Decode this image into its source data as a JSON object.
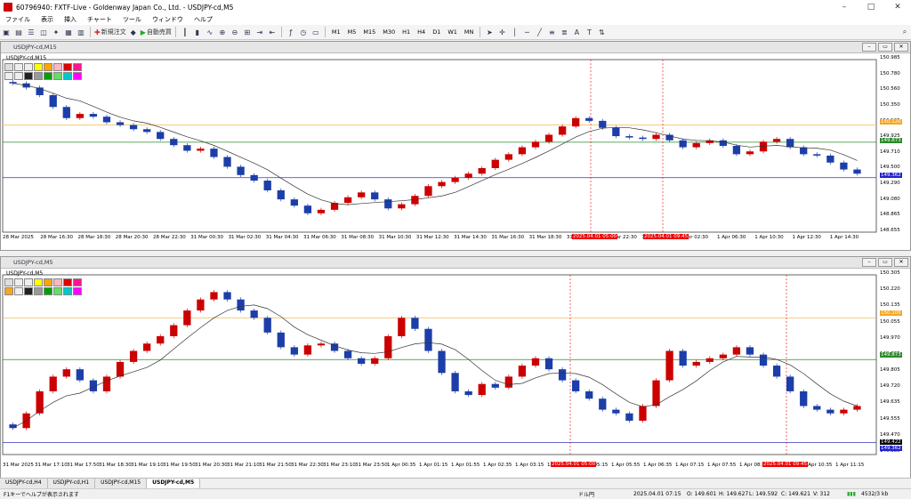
{
  "window": {
    "title": "60796940: FXTF-Live - Goldenway Japan Co., Ltd. - USDJPY-cd,M5"
  },
  "menu": [
    "ファイル",
    "表示",
    "挿入",
    "チャート",
    "ツール",
    "ウィンドウ",
    "ヘルプ"
  ],
  "toolbar": {
    "new_order": "新規注文",
    "auto_trade": "自動売買",
    "timeframes": [
      "M1",
      "M5",
      "M15",
      "M30",
      "H1",
      "H4",
      "D1",
      "W1",
      "MN"
    ]
  },
  "chart_top": {
    "title": "USDJPY-cd,M15",
    "label": "USDJPY-cd,M15",
    "level_tags": [
      "150.120",
      "149.873",
      "149.362"
    ],
    "price_ticks": [
      "150.985",
      "150.780",
      "150.560",
      "150.350",
      "150.135",
      "149.925",
      "149.710",
      "149.500",
      "149.290",
      "149.080",
      "148.865",
      "148.655"
    ],
    "time_ticks": [
      "28 Mar 2025",
      "28 Mar 16:30",
      "28 Mar 18:30",
      "28 Mar 20:30",
      "28 Mar 22:30",
      "31 Mar 00:30",
      "31 Mar 02:30",
      "31 Mar 04:30",
      "31 Mar 06:30",
      "31 Mar 08:30",
      "31 Mar 10:30",
      "31 Mar 12:30",
      "31 Mar 14:30",
      "31 Mar 16:30",
      "31 Mar 18:30",
      "31 Mar 20:30",
      "31 Mar 22:30",
      "1 Apr 00:30",
      "1 Apr 02:30",
      "1 Apr 06:30",
      "1 Apr 10:30",
      "1 Apr 12:30",
      "1 Apr 14:30"
    ],
    "time_tags": [
      "2025.04.01 05:00",
      "2025.04.01 09:45"
    ],
    "chart_data": {
      "type": "candlestick",
      "series": [
        {
          "values": [
            150.72,
            150.66,
            150.55,
            150.38,
            150.22,
            150.28,
            150.24,
            150.16,
            150.12,
            150.06,
            150.02,
            149.92,
            149.83,
            149.75,
            149.78,
            149.66,
            149.52,
            149.4,
            149.32,
            149.18,
            149.05,
            148.96,
            148.85,
            148.9,
            149.0,
            149.08,
            149.15,
            149.05,
            148.92,
            148.98,
            149.1,
            149.24,
            149.3,
            149.36,
            149.42,
            149.5,
            149.62,
            149.7,
            149.8,
            149.88,
            149.98,
            150.1,
            150.22,
            150.18,
            150.08,
            149.96,
            149.94,
            149.92,
            149.98,
            149.9,
            149.8,
            149.86,
            149.9,
            149.82,
            149.7,
            149.74,
            149.88,
            149.92,
            149.8,
            149.7,
            149.68,
            149.58,
            149.48,
            149.42
          ]
        }
      ],
      "levels": [
        150.12,
        149.873,
        149.362
      ],
      "ylim": [
        148.655,
        150.985
      ]
    }
  },
  "chart_bottom": {
    "title": "USDJPY-cd,M5",
    "label": "USDJPY-cd,M5",
    "level_tags": [
      "150.100",
      "149.873",
      "149.422",
      "149.362"
    ],
    "price_ticks": [
      "150.305",
      "150.220",
      "150.135",
      "150.055",
      "149.970",
      "149.885",
      "149.805",
      "149.720",
      "149.635",
      "149.555",
      "149.470",
      "149.385"
    ],
    "time_ticks": [
      "31 Mar 2025",
      "31 Mar 17:10",
      "31 Mar 17:50",
      "31 Mar 18:30",
      "31 Mar 19:10",
      "31 Mar 19:50",
      "31 Mar 20:30",
      "31 Mar 21:10",
      "31 Mar 21:50",
      "31 Mar 22:30",
      "31 Mar 23:10",
      "31 Mar 23:50",
      "1 Apr 00:35",
      "1 Apr 01:15",
      "1 Apr 01:55",
      "1 Apr 02:35",
      "1 Apr 03:15",
      "1 Apr 03:55",
      "1 Apr 05:15",
      "1 Apr 05:55",
      "1 Apr 06:35",
      "1 Apr 07:15",
      "1 Apr 07:55",
      "1 Apr 08:35",
      "1 Apr 09:55",
      "1 Apr 10:35",
      "1 Apr 11:15"
    ],
    "time_tags": [
      "2025.04.01 05:00",
      "2025.04.01 09:45"
    ],
    "chart_data": {
      "type": "candlestick",
      "series": [
        {
          "values": [
            149.5,
            149.58,
            149.7,
            149.78,
            149.82,
            149.76,
            149.7,
            149.78,
            149.86,
            149.92,
            149.96,
            150.0,
            150.06,
            150.14,
            150.2,
            150.24,
            150.2,
            150.14,
            150.1,
            150.02,
            149.94,
            149.9,
            149.95,
            149.96,
            149.92,
            149.88,
            149.85,
            149.88,
            150.0,
            150.1,
            150.04,
            149.92,
            149.8,
            149.7,
            149.68,
            149.74,
            149.72,
            149.78,
            149.84,
            149.88,
            149.82,
            149.76,
            149.7,
            149.66,
            149.6,
            149.58,
            149.54,
            149.62,
            149.76,
            149.92,
            149.84,
            149.86,
            149.88,
            149.9,
            149.94,
            149.9,
            149.84,
            149.78,
            149.7,
            149.62,
            149.6,
            149.58,
            149.6,
            149.62
          ]
        }
      ],
      "levels": [
        150.1,
        149.873,
        149.422
      ],
      "ylim": [
        149.385,
        150.305
      ]
    }
  },
  "tabs": [
    "USDJPY-cd,H4",
    "USDJPY-cd,H1",
    "USDJPY-cd,M15",
    "USDJPY-cd,M5"
  ],
  "status": {
    "help": "F1キーでヘルプが表示されます",
    "profile": "ドル円",
    "datetime": "2025.04.01 07:15",
    "open": "O: 149.601",
    "high": "H: 149.627",
    "low": "L: 149.592",
    "close": "C: 149.621",
    "volume": "V: 312",
    "traffic": "4532/3 kb"
  }
}
